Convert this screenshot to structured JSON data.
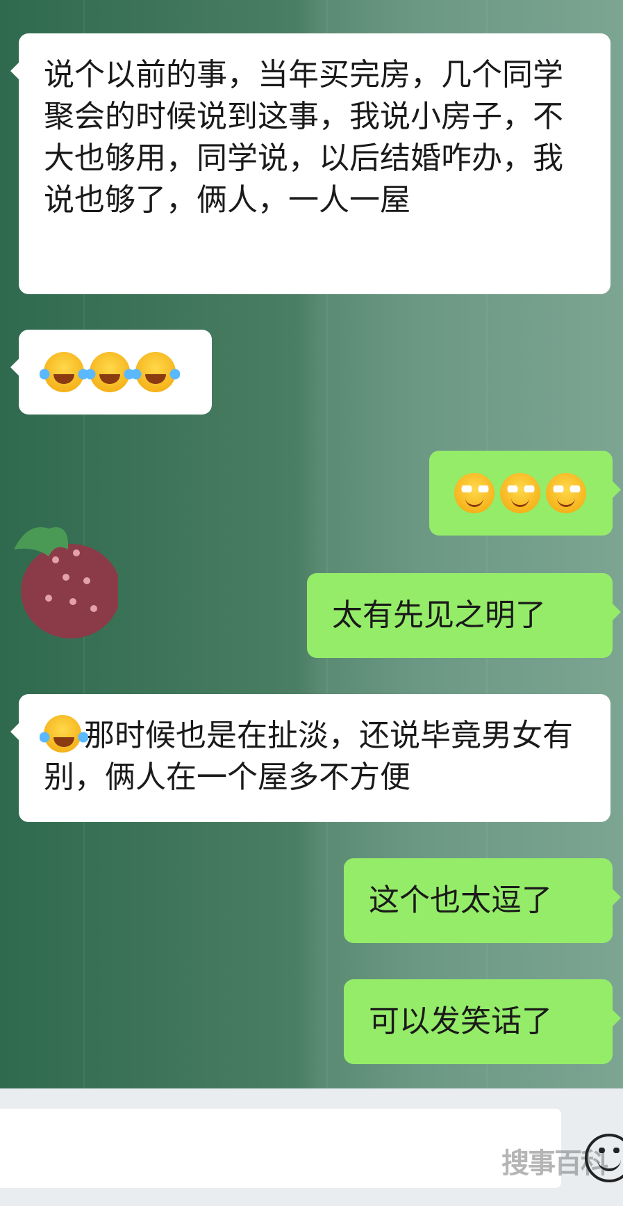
{
  "messages": [
    {
      "side": "left",
      "text": "说个以前的事，当年买完房，几个同学聚会的时候说到这事，我说小房子，不大也够用，同学说，以后结婚咋办，我说也够了，俩人，一人一屋"
    },
    {
      "side": "left",
      "emoji": [
        "laugh-tears-emoji",
        "laugh-tears-emoji",
        "laugh-tears-emoji"
      ]
    },
    {
      "side": "right",
      "emoji": [
        "smirk-emoji",
        "smirk-emoji",
        "smirk-emoji"
      ]
    },
    {
      "side": "right",
      "text": "太有先见之明了"
    },
    {
      "side": "left",
      "text": "那时候也是在扯淡，还说毕竟男女有别，俩人在一个屋多不方便"
    },
    {
      "side": "right",
      "text": "这个也太逗了"
    },
    {
      "side": "right",
      "text": "可以发笑话了"
    }
  ],
  "input": {
    "placeholder": ""
  },
  "watermark": "搜事百科",
  "colors": {
    "incoming": "#ffffff",
    "outgoing": "#95ec69",
    "input_bar": "#e9edf0"
  }
}
